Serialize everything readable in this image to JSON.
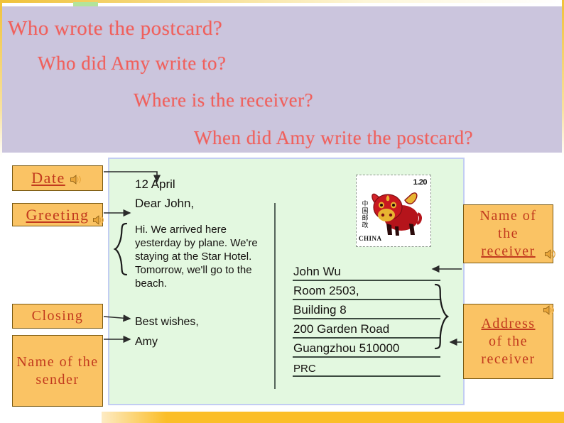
{
  "slide": {
    "accent_orange": "#fac364",
    "accent_red": "#c23a1e",
    "banner_bg": "#cbc5dd",
    "question_color": "#f0605c",
    "postcard_bg": "#e3f8e0",
    "postcard_border": "#c2cdf2",
    "bottom_bar_color": "#fbbe28"
  },
  "questions": {
    "q1": "Who wrote the postcard?",
    "q2": "Who did Amy write to?",
    "q3": "Where is the receiver?",
    "q4": "When did Amy write the postcard?"
  },
  "postcard": {
    "date": "12 April",
    "greeting": "Dear John,",
    "body": "Hi. We arrived here yesterday by plane. We're staying at the Star Hotel. Tomorrow, we'll go to the beach.",
    "closing": "Best wishes,",
    "signature": "Amy",
    "address": [
      {
        "text": "John Wu",
        "size": "normal"
      },
      {
        "text": "Room 2503,",
        "size": "normal"
      },
      {
        "text": "Building 8",
        "size": "normal"
      },
      {
        "text": "200 Garden  Road",
        "size": "normal"
      },
      {
        "text": "Guangzhou 510000",
        "size": "normal"
      },
      {
        "text": "PRC",
        "size": "small"
      }
    ]
  },
  "stamp": {
    "denomination": "1.20",
    "issuer_cn": "中国邮政",
    "country": "CHINA",
    "motif": "ox-zodiac"
  },
  "labels": {
    "date": {
      "underlined": "Date",
      "rest": ""
    },
    "greeting": {
      "underlined": "Greeting",
      "rest": ""
    },
    "closing": {
      "underlined": "",
      "rest": "Closing"
    },
    "sender": {
      "underlined": "",
      "rest": "Name of the sender"
    },
    "receiver": {
      "line1": "Name  of",
      "line2": "the",
      "underlined": "receiver"
    },
    "address": {
      "underlined": "Address",
      "line2": "of  the",
      "line3": "receiver"
    }
  },
  "icons": {
    "speaker": "speaker-icon"
  }
}
